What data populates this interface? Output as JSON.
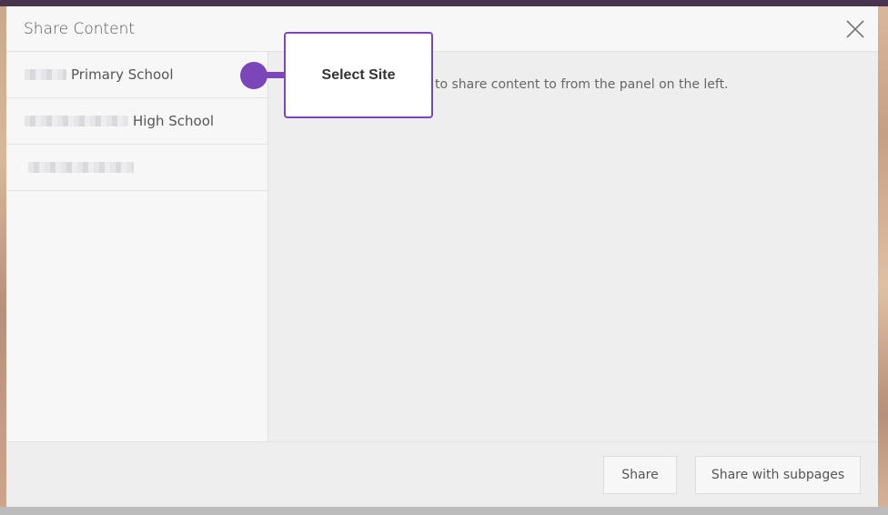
{
  "modal": {
    "title": "Share Content"
  },
  "sidebar": {
    "items": [
      {
        "label": "Primary School"
      },
      {
        "label": "High School"
      },
      {
        "label": ""
      }
    ]
  },
  "main": {
    "instruction": "to share content to from the panel on the left."
  },
  "footer": {
    "share_label": "Share",
    "share_subpages_label": "Share with subpages"
  },
  "callout": {
    "label": "Select Site"
  },
  "colors": {
    "accent": "#7b47b8",
    "panel_bg": "#f7f7f7",
    "main_bg": "#eeeeee",
    "border": "#e2e2e2"
  }
}
